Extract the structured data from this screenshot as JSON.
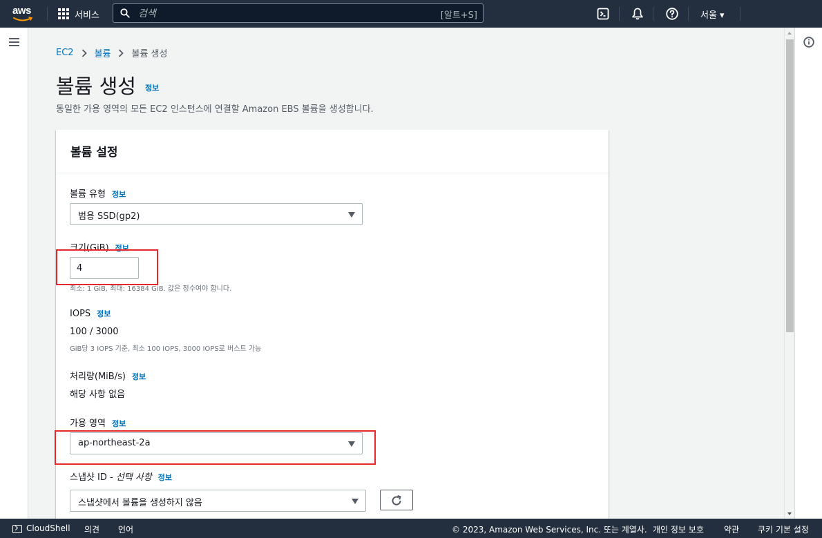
{
  "topnav": {
    "logo_text": "aws",
    "services_label": "서비스",
    "search_placeholder": "검색",
    "search_shortcut": "[알트+S]",
    "region_label": "서울 ▾"
  },
  "breadcrumb": {
    "items": [
      "EC2",
      "볼륨"
    ],
    "current": "볼륨 생성"
  },
  "header": {
    "title": "볼륨 생성",
    "info": "정보",
    "description": "동일한 가용 영역의 모든 EC2 인스턴스에 연결할 Amazon EBS 볼륨을 생성합니다."
  },
  "panel": {
    "title": "볼륨 설정",
    "volume_type": {
      "label": "볼륨 유형",
      "info": "정보",
      "value": "범용 SSD(gp2)"
    },
    "size": {
      "label": "크기(GiB)",
      "info": "정보",
      "value": "4",
      "hint": "최소: 1 GiB, 최대: 16384 GiB. 값은 정수여야 합니다."
    },
    "iops": {
      "label": "IOPS",
      "info": "정보",
      "value": "100 / 3000",
      "hint": "GiB당 3 IOPS 기준, 최소 100 IOPS, 3000 IOPS로 버스트 가능"
    },
    "throughput": {
      "label": "처리량(MiB/s)",
      "info": "정보",
      "value": "해당 사항 없음"
    },
    "availability_zone": {
      "label": "가용 영역",
      "info": "정보",
      "value": "ap-northeast-2a"
    },
    "snapshot": {
      "label": "스냅샷 ID - ",
      "label_optional": "선택 사항",
      "info": "정보",
      "value": "스냅샷에서 볼륨을 생성하지 않음"
    }
  },
  "footer": {
    "cloudshell": "CloudShell",
    "feedback": "의견",
    "language": "언어",
    "copyright": "© 2023, Amazon Web Services, Inc. 또는 계열사.",
    "privacy": "개인 정보 보호",
    "terms": "약관",
    "cookies": "쿠키 기본 설정"
  },
  "colors": {
    "nav_bg": "#232f3e",
    "link": "#0073bb",
    "highlight_box": "#e8272b"
  },
  "icons": [
    "aws-logo",
    "grid-icon",
    "search-icon",
    "cloudshell-icon",
    "bell-icon",
    "help-icon",
    "menu-icon",
    "info-circle-icon",
    "refresh-icon",
    "chevron-right-icon",
    "caret-down-icon"
  ]
}
